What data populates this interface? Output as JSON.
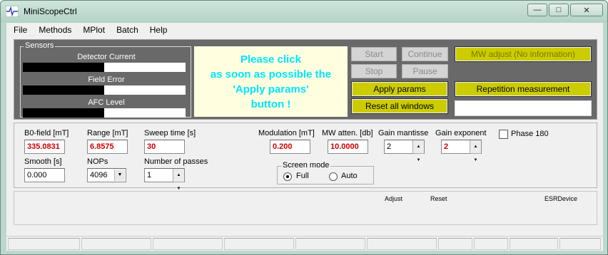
{
  "window": {
    "title": "MiniScopeCtrl",
    "icon": "waveform-icon",
    "controls": {
      "minimize": "—",
      "maximize": "□",
      "close": "✕"
    },
    "colors": {
      "frame": "#bcd8cd",
      "panel": "#696969",
      "accent_button": "#cccc00",
      "message_text": "#00e5ff",
      "value_red": "#cc0000"
    }
  },
  "menu": [
    "File",
    "Methods",
    "MPlot",
    "Batch",
    "Help"
  ],
  "sensors": {
    "legend": "Sensors",
    "items": [
      {
        "label": "Detector Current",
        "level": 0.5
      },
      {
        "label": "Field Error",
        "level": 0.5
      },
      {
        "label": "AFC Level",
        "level": 0.5
      }
    ]
  },
  "message": "Please click\nas soon as possible the\n'Apply params'\nbutton !",
  "buttons": {
    "start": "Start",
    "continue": "Continue",
    "stop": "Stop",
    "pause": "Pause",
    "apply_params": "Apply params",
    "reset_all": "Reset all windows",
    "mw_adjust": "MW adjust (No information)",
    "repetition": "Repetition measurement"
  },
  "params": {
    "b0_field": {
      "label": "B0-field [mT]",
      "value": "335.0831"
    },
    "range": {
      "label": "Range [mT]",
      "value": "6.8575"
    },
    "sweep_time": {
      "label": "Sweep time [s]",
      "value": "30"
    },
    "modulation": {
      "label": "Modulation [mT]",
      "value": "0.200"
    },
    "mw_atten": {
      "label": "MW atten. [db]",
      "value": "10.0000"
    },
    "gain_mantisse": {
      "label": "Gain mantisse",
      "value": "2"
    },
    "gain_exponent": {
      "label": "Gain exponent",
      "value": "2"
    },
    "phase180": {
      "label": "Phase 180",
      "checked": false
    },
    "smooth": {
      "label": "Smooth [s]",
      "value": "0.000"
    },
    "nops": {
      "label": "NOPs",
      "value": "4096"
    },
    "passes": {
      "label": "Number of passes",
      "value": "1"
    }
  },
  "screen_mode": {
    "legend": "Screen mode",
    "options": [
      {
        "label": "Full",
        "selected": true
      },
      {
        "label": "Auto",
        "selected": false
      }
    ]
  },
  "plot": {
    "adjust": "Adjust",
    "reset": "Reset",
    "device": "ESRDevice"
  }
}
